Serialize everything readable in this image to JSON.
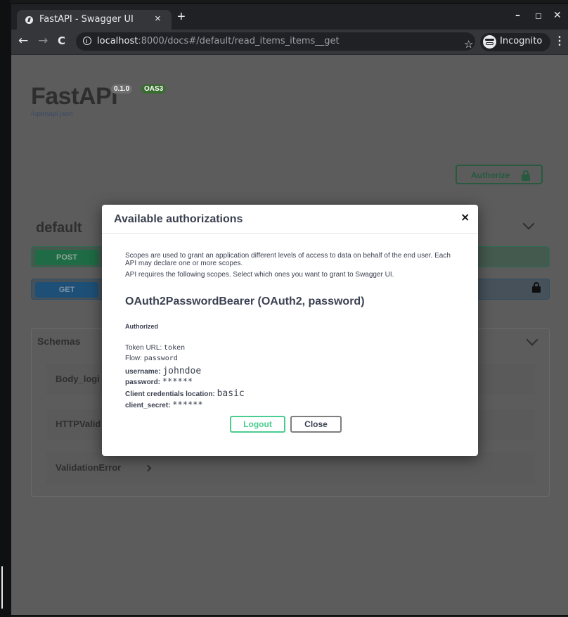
{
  "browser": {
    "tab_title": "FastAPI - Swagger UI",
    "tab_close": "×",
    "new_tab": "+",
    "window_controls": {
      "minimize": "–",
      "maximize": "◻",
      "close": "✕"
    },
    "nav": {
      "back": "←",
      "forward": "→",
      "reload": "C"
    },
    "url_host": "localhost",
    "url_path": ":8000/docs#/default/read_items_items__get",
    "star": "☆",
    "incognito_label": "Incognito",
    "menu": "⋮"
  },
  "swagger": {
    "title": "FastAPI",
    "version": "0.1.0",
    "oas": "OAS3",
    "openapi_link": "/openapi.json",
    "authorize_label": "Authorize",
    "section_title": "default",
    "operations": [
      {
        "method": "POST"
      },
      {
        "method": "GET"
      }
    ],
    "schemas_title": "Schemas",
    "models": [
      "Body_logi",
      "HTTPValid",
      "ValidationError"
    ]
  },
  "dialog": {
    "title": "Available authorizations",
    "close_icon": "×",
    "description_1": "Scopes are used to grant an application different levels of access to data on behalf of the end user. Each API may declare one or more scopes.",
    "description_2": "API requires the following scopes. Select which ones you want to grant to Swagger UI.",
    "scheme": "OAuth2PasswordBearer (OAuth2, password)",
    "status": "Authorized",
    "token_url_label": "Token URL:",
    "token_url_value": "token",
    "flow_label": "Flow:",
    "flow_value": "password",
    "username_label": "username:",
    "username_value": "johndoe",
    "password_label": "password:",
    "password_value": "******",
    "client_location_label": "Client credentials location:",
    "client_location_value": "basic",
    "client_secret_label": "client_secret:",
    "client_secret_value": "******",
    "logout_label": "Logout",
    "close_label": "Close"
  },
  "colors": {
    "post": "#49cc90",
    "get": "#61affe",
    "authorize": "#49cc90"
  }
}
